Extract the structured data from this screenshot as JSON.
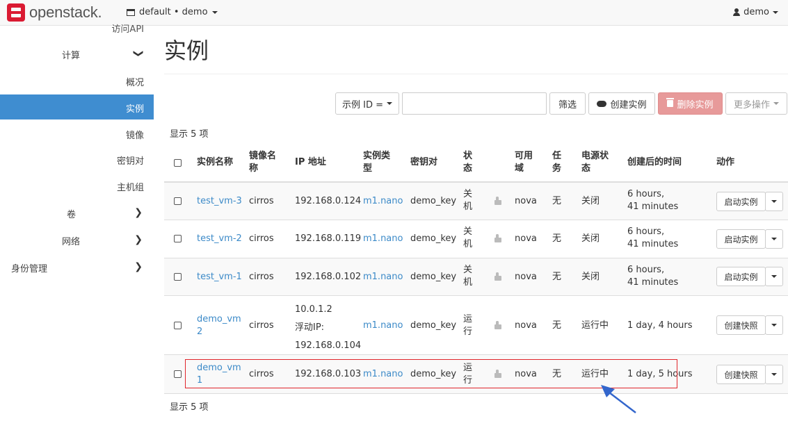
{
  "topbar": {
    "brand": "openstack.",
    "project": "default • demo",
    "user": "demo"
  },
  "sidebar": {
    "cut_item": "访问API",
    "items": [
      {
        "label": "计算",
        "chevron": "❯"
      },
      {
        "label": "概况"
      },
      {
        "label": "实例"
      },
      {
        "label": "镜像"
      },
      {
        "label": "密钥对"
      },
      {
        "label": "主机组"
      },
      {
        "label": "卷",
        "chevron": "❯"
      },
      {
        "label": "网络",
        "chevron": "❯"
      },
      {
        "label": "身份管理",
        "chevron": "❯"
      }
    ]
  },
  "main": {
    "title": "实例",
    "filter_field": "示例 ID =",
    "filter_value": "",
    "filter_button": "筛选",
    "create_button": "创建实例",
    "delete_button": "删除实例",
    "more_button": "更多操作",
    "count_top": "显示 5 项",
    "count_bottom": "显示 5 项"
  },
  "table": {
    "headers": [
      "实例名称",
      "镜像名称",
      "IP 地址",
      "实例类型",
      "密钥对",
      "状态",
      "可用域",
      "任务",
      "电源状态",
      "创建后的时间",
      "动作"
    ],
    "header_lines": {
      "image": [
        "镜像名",
        "称"
      ],
      "flavor": [
        "实例类",
        "型"
      ],
      "status": [
        "状",
        "态"
      ],
      "az": [
        "可用",
        "域"
      ],
      "task": [
        "任",
        "务"
      ],
      "power": [
        "电源状",
        "态"
      ]
    },
    "rows": [
      {
        "name": [
          "test_vm-3"
        ],
        "image": "cirros",
        "ip": [
          "192.168.0.124"
        ],
        "flavor": "m1.nano",
        "key": "demo_key",
        "status": [
          "关",
          "机"
        ],
        "az": "nova",
        "task": "无",
        "power": "关闭",
        "age": [
          "6 hours,",
          "41 minutes"
        ],
        "action": "启动实例"
      },
      {
        "name": [
          "test_vm-2"
        ],
        "image": "cirros",
        "ip": [
          "192.168.0.119"
        ],
        "flavor": "m1.nano",
        "key": "demo_key",
        "status": [
          "关",
          "机"
        ],
        "az": "nova",
        "task": "无",
        "power": "关闭",
        "age": [
          "6 hours,",
          "41 minutes"
        ],
        "action": "启动实例"
      },
      {
        "name": [
          "test_vm-1"
        ],
        "image": "cirros",
        "ip": [
          "192.168.0.102"
        ],
        "flavor": "m1.nano",
        "key": "demo_key",
        "status": [
          "关",
          "机"
        ],
        "az": "nova",
        "task": "无",
        "power": "关闭",
        "age": [
          "6 hours,",
          "41 minutes"
        ],
        "action": "启动实例"
      },
      {
        "name": [
          "demo_vm",
          "2"
        ],
        "image": "cirros",
        "ip": [
          "10.0.1.2",
          "浮动IP:",
          "192.168.0.104"
        ],
        "flavor": "m1.nano",
        "key": "demo_key",
        "status": [
          "运",
          "行"
        ],
        "az": "nova",
        "task": "无",
        "power": "运行中",
        "age": [
          "1 day, 4 hours"
        ],
        "action": "创建快照"
      },
      {
        "name": [
          "demo_vm",
          "1"
        ],
        "image": "cirros",
        "ip": [
          "192.168.0.103"
        ],
        "flavor": "m1.nano",
        "key": "demo_key",
        "status": [
          "运",
          "行"
        ],
        "az": "nova",
        "task": "无",
        "power": "运行中",
        "age": [
          "1 day, 5 hours"
        ],
        "action": "创建快照"
      }
    ]
  },
  "colors": {
    "brand_red": "#da1a32",
    "sidebar_active": "#3f8dd0",
    "link": "#3c8ac8",
    "danger_button": "#e79a9a",
    "annotation_box": "#e0242a",
    "annotation_arrow": "#3366cc"
  },
  "icons": {
    "logo": "openstack-logo-icon",
    "project": "project-icon",
    "user": "user-icon",
    "create": "cloud-upload-icon",
    "delete": "trash-icon",
    "console_lock": "lock-icon"
  }
}
